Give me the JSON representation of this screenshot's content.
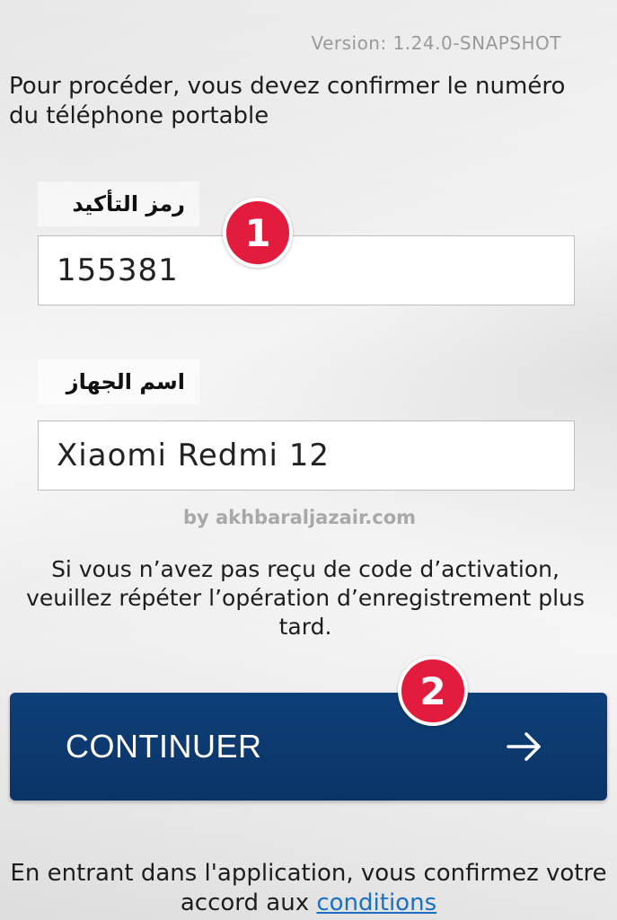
{
  "version_text": "Version: 1.24.0-SNAPSHOT",
  "intro_text": "Pour procéder, vous devez confirmer le numéro du téléphone portable",
  "code_field": {
    "label": "رمز التأكيد",
    "value": "155381"
  },
  "device_field": {
    "label": "اسم الجهاز",
    "value": "Xiaomi Redmi 12"
  },
  "badges": [
    "1",
    "2"
  ],
  "watermark": "by akhbaraljazair.com",
  "notice_text": "Si vous n’avez pas reçu de code d’activation, veuillez répéter l’opération d’enregistrement plus tard.",
  "continue_button": {
    "label": "CONTINUER",
    "icon": "arrow-right-icon"
  },
  "footer": {
    "text": "En entrant dans l'application, vous confirmez votre accord aux",
    "link_text": "conditions"
  },
  "colors": {
    "button": "#0e3f78",
    "badge": "#e31b3c",
    "link": "#1a6fc2"
  }
}
